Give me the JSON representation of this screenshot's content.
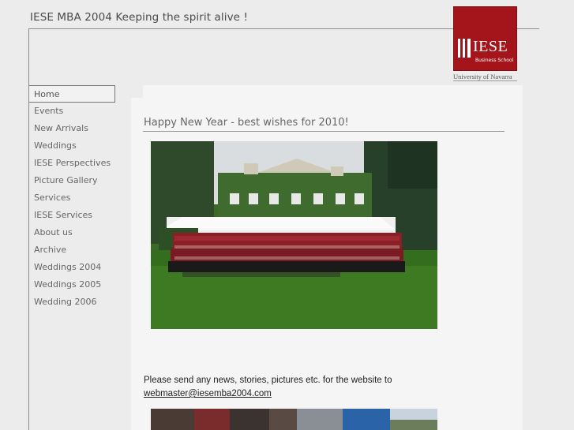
{
  "site": {
    "title": "IESE MBA 2004 Keeping the spirit alive !"
  },
  "logo": {
    "name": "IESE",
    "subtitle": "Business School",
    "caption": "University of Navarra",
    "color": "#a3141b"
  },
  "nav": {
    "items": [
      {
        "label": "Home",
        "active": true
      },
      {
        "label": "Events"
      },
      {
        "label": "New Arrivals"
      },
      {
        "label": "Weddings"
      },
      {
        "label": "IESE Perspectives"
      },
      {
        "label": "Picture Gallery"
      },
      {
        "label": "Services"
      },
      {
        "label": "IESE Services"
      },
      {
        "label": "About us"
      },
      {
        "label": "Archive"
      },
      {
        "label": "Weddings 2004"
      },
      {
        "label": "Weddings 2005"
      },
      {
        "label": "Wedding 2006"
      }
    ]
  },
  "post": {
    "title": "Happy New Year - best wishes for 2010!",
    "message": "Please send any news, stories, pictures etc. for the website to",
    "email": "webmaster@iesemba2004.com"
  }
}
